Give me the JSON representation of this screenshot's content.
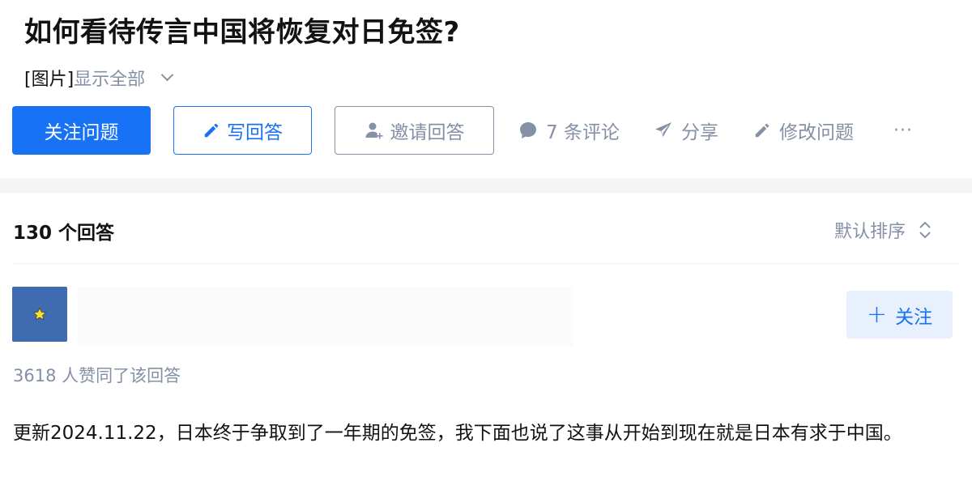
{
  "question": {
    "title": "如何看待传言中国将恢复对日免签?",
    "detail_prefix": "[图片]",
    "show_all_label": "显示全部"
  },
  "actions": {
    "follow_label": "关注问题",
    "write_label": "写回答",
    "invite_label": "邀请回答",
    "comments_label": "7 条评论",
    "share_label": "分享",
    "edit_label": "修改问题",
    "more_label": "···"
  },
  "answers": {
    "count_label": "130 个回答",
    "sort_label": "默认排序"
  },
  "answer": {
    "follow_label": "关注",
    "upvotes_label": "3618 人赞同了该回答",
    "text": "更新2024.11.22，日本终于争取到了一年期的免签，我下面也说了这事从开始到现在就是日本有求于中国。"
  },
  "colors": {
    "brand_blue": "#1772f6",
    "secondary_gray": "#8590a6",
    "avatar_bg": "#3f6bb0",
    "avatar_star": "#f5e12a"
  }
}
